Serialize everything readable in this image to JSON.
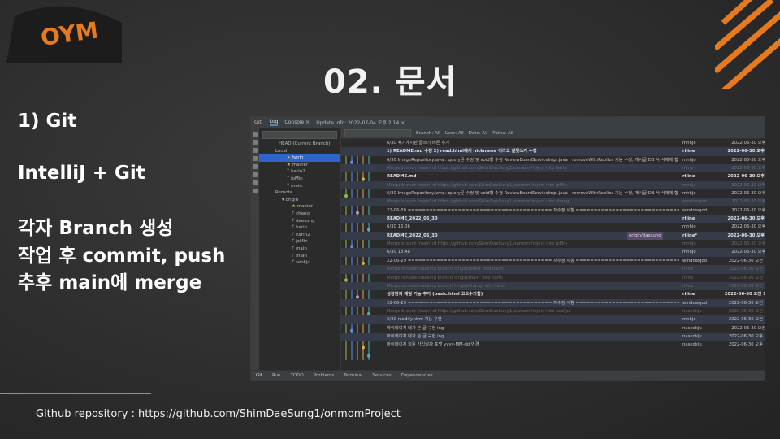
{
  "slide": {
    "title": "02. 문서",
    "section_heading": "1) Git",
    "subheading": "IntelliJ  +  Git",
    "steps": [
      "각자 Branch 생성",
      "작업 후 commit, push",
      "추후 main에 merge"
    ],
    "repo_text": "Github  repository : https://github.com/ShimDaeSung1/onmomProject",
    "colors": {
      "accent": "#e87a1e",
      "logo_bg": "#1c1c1c",
      "logo_text": "#e87a1e"
    }
  },
  "ide": {
    "tabs": [
      "Git:",
      "Log",
      "Console ×",
      "Update Info: 2022-07-04 오후 2:14 ×"
    ],
    "toolbar": [
      "Branch: All",
      "User: All",
      "Date: All",
      "Paths: All"
    ],
    "branches": {
      "head": "HEAD (Current Branch)",
      "local_label": "Local",
      "local": [
        "harin",
        "master",
        "harin2",
        "joMin",
        "main"
      ],
      "remote_label": "Remote",
      "origin_label": "origin",
      "remote": [
        "master",
        "chang",
        "daesung",
        "harin",
        "harin2",
        "joMin",
        "main",
        "mian",
        "seokju"
      ]
    },
    "commits": [
      {
        "msg": "6/30 후기게시판 글쓰기 버튼 추가",
        "author": "mhhjo",
        "date": "2022-06-30 오후 6:02",
        "style": ""
      },
      {
        "msg": "1) README.md 수정 2) read.html에서 nickname 이라고 잘못쓰거 수정",
        "author": "riiine",
        "date": "2022-06-30 오후 5:49",
        "style": "bold"
      },
      {
        "msg": "6/30 ImageRepository.java : query문 수정 및 void형 수정 ReviewBoardServiceImpl.java : removeWithReplies 기능 수정, 게시글 DB 삭 삭제에 함",
        "author": "mhhjo",
        "date": "2022-06-30 오후 5:45",
        "style": ""
      },
      {
        "msg": "Merge branch 'main' of https://github.com/ShimDaeSung1/onmomProject into harin",
        "author": "riiine",
        "date": "2022-06-30 오후 5:38",
        "style": "dim"
      },
      {
        "msg": "README.md",
        "author": "riiine",
        "date": "2022-06-30 오후 5:38",
        "style": "bold"
      },
      {
        "msg": "Merge branch 'main' of https://github.com/ShimDaeSung1/onmomProject into joMin",
        "author": "mhhjo",
        "date": "2022-06-30 오후 5:37",
        "style": "dim"
      },
      {
        "msg": "6/30 ImageRepository.java : query문 수정 및 void형 수정 ReviewBoardServiceImpl.java : removeWithReplies 기능 수정, 게시글 DB 삭 삭제에 함",
        "author": "mhhjo",
        "date": "2022-06-30 오후 5:36",
        "style": ""
      },
      {
        "msg": "Merge branch 'main' of https://github.com/ShimDaeSung1/onmomProject into chang",
        "author": "windowgod",
        "date": "2022-06-30 오후 4:50",
        "style": "dim"
      },
      {
        "msg": "22-06-30 ======================================== 저수정 사항 ======================================== ···",
        "author": "windowgod",
        "date": "2022-06-30 오후 4:30",
        "style": ""
      },
      {
        "msg": "README_2022_06_30",
        "author": "riiine",
        "date": "2022-06-30 오후 4:06",
        "style": "bold"
      },
      {
        "msg": "6/30 16:06",
        "author": "mhhjo",
        "date": "2022-06-30 오후 4:06",
        "style": ""
      },
      {
        "msg": "README_2022_06_30",
        "author": "riiine*",
        "date": "2022-06-30 오후 4:04",
        "style": "bold",
        "tag": "origin/daesung"
      },
      {
        "msg": "Merge branch 'main' of https://github.com/ShimDaeSung1/onmomProject into joMin",
        "author": "mhhjo",
        "date": "2022-06-30 오후 1:50",
        "style": "dim"
      },
      {
        "msg": "6/30 13:48",
        "author": "mhhjo",
        "date": "2022-06-30 오후 1:49",
        "style": ""
      },
      {
        "msg": "22-06-29 ======================================== 저수정 사항 ======================================== ···",
        "author": "windowgod",
        "date": "2022-06-30 오전 11:12",
        "style": ""
      },
      {
        "msg": "Merge remote-tracking branch 'origin/joMin' into harin",
        "author": "riiine",
        "date": "2022-06-30 오전 10:17",
        "style": "dim"
      },
      {
        "msg": "Merge remote-tracking branch 'origin/main' into harin",
        "author": "riiine",
        "date": "2022-06-30 오전 10:15",
        "style": "dim"
      },
      {
        "msg": "Merge remote-tracking branch 'origin/chang' into harin",
        "author": "riiine",
        "date": "2022-06-30 오전 10:13",
        "style": "dim"
      },
      {
        "msg": "성장원과 재팅 기능 추가 (basic.html 코드수가함)",
        "author": "riiine",
        "date": "2022-06-30 오전 10:13",
        "style": "bold"
      },
      {
        "msg": "22-06-29 ======================================== 저수정 사항 ======================================== ···",
        "author": "windowgod",
        "date": "2022-06-30 오전 10:13",
        "style": ""
      },
      {
        "msg": "Merge branch 'main' of https://github.com/ShimDaeSung1/onmomProject into seokju",
        "author": "naseokju",
        "date": "2022-06-30 오전 10:05",
        "style": "dim"
      },
      {
        "msg": "6/30 modify.html 기능 구현",
        "author": "mhhjo",
        "date": "2022-06-30 오전 10:04",
        "style": ""
      },
      {
        "msg": "마이페이지 내가 쓴 글 구현 ing",
        "author": "naseokju",
        "date": "2022-06-30 오전 9:54",
        "style": ""
      },
      {
        "msg": "마이페이지 내가 쓴 글 구현 ing",
        "author": "naseokju",
        "date": "2022-06-30 오후 12:39",
        "style": ""
      },
      {
        "msg": "마이페이지 회원 가입날짜 포맷 yyyy-MM-dd 변경",
        "author": "naseokju",
        "date": "2022-06-30 오후 12:23",
        "style": ""
      }
    ],
    "status": [
      "Git",
      "Run",
      "TODO",
      "Problems",
      "Terminal",
      "Services",
      "Dependencies"
    ]
  }
}
